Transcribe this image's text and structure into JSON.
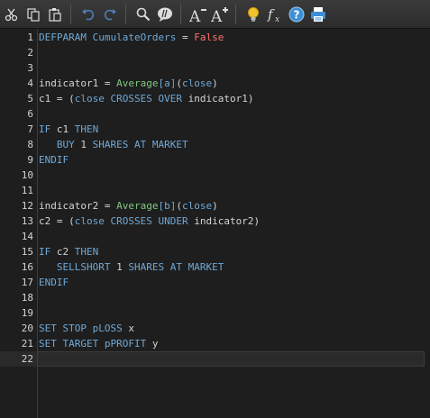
{
  "toolbar": {
    "icons": [
      "scissors-icon",
      "copy-icon",
      "paste-icon",
      "undo-icon",
      "redo-icon",
      "search-icon",
      "comment-icon",
      "decrease-font-icon",
      "increase-font-icon",
      "lightbulb-icon",
      "function-icon",
      "help-icon",
      "print-icon"
    ],
    "colors": {
      "bulb": "#f2c230",
      "help": "#3d8fd6",
      "print": "#3d8fd6"
    }
  },
  "editor": {
    "lines": [
      {
        "n": "1",
        "tokens": [
          [
            "kw",
            "DEFPARAM CumulateOrders"
          ],
          [
            "tx",
            " = "
          ],
          [
            "bl",
            "False"
          ]
        ]
      },
      {
        "n": "2",
        "tokens": []
      },
      {
        "n": "3",
        "tokens": []
      },
      {
        "n": "4",
        "tokens": [
          [
            "tx",
            "indicator1 = "
          ],
          [
            "fn",
            "Average"
          ],
          [
            "br",
            "[a]"
          ],
          [
            "tx",
            "("
          ],
          [
            "kw",
            "close"
          ],
          [
            "tx",
            ")"
          ]
        ]
      },
      {
        "n": "5",
        "tokens": [
          [
            "tx",
            "c1 = ("
          ],
          [
            "kw",
            "close CROSSES OVER"
          ],
          [
            "tx",
            " indicator1)"
          ]
        ]
      },
      {
        "n": "6",
        "tokens": []
      },
      {
        "n": "7",
        "tokens": [
          [
            "kw",
            "IF"
          ],
          [
            "tx",
            " c1 "
          ],
          [
            "kw",
            "THEN"
          ]
        ]
      },
      {
        "n": "8",
        "tokens": [
          [
            "tx",
            "   "
          ],
          [
            "kw",
            "BUY"
          ],
          [
            "tx",
            " 1 "
          ],
          [
            "kw",
            "SHARES AT MARKET"
          ]
        ]
      },
      {
        "n": "9",
        "tokens": [
          [
            "kw",
            "ENDIF"
          ]
        ]
      },
      {
        "n": "10",
        "tokens": []
      },
      {
        "n": "11",
        "tokens": []
      },
      {
        "n": "12",
        "tokens": [
          [
            "tx",
            "indicator2 = "
          ],
          [
            "fn",
            "Average"
          ],
          [
            "br",
            "[b]"
          ],
          [
            "tx",
            "("
          ],
          [
            "kw",
            "close"
          ],
          [
            "tx",
            ")"
          ]
        ]
      },
      {
        "n": "13",
        "tokens": [
          [
            "tx",
            "c2 = ("
          ],
          [
            "kw",
            "close CROSSES UNDER"
          ],
          [
            "tx",
            " indicator2)"
          ]
        ]
      },
      {
        "n": "14",
        "tokens": []
      },
      {
        "n": "15",
        "tokens": [
          [
            "kw",
            "IF"
          ],
          [
            "tx",
            " c2 "
          ],
          [
            "kw",
            "THEN"
          ]
        ]
      },
      {
        "n": "16",
        "tokens": [
          [
            "tx",
            "   "
          ],
          [
            "kw",
            "SELLSHORT"
          ],
          [
            "tx",
            " 1 "
          ],
          [
            "kw",
            "SHARES AT MARKET"
          ]
        ]
      },
      {
        "n": "17",
        "tokens": [
          [
            "kw",
            "ENDIF"
          ]
        ]
      },
      {
        "n": "18",
        "tokens": []
      },
      {
        "n": "19",
        "tokens": []
      },
      {
        "n": "20",
        "tokens": [
          [
            "kw",
            "SET STOP pLOSS"
          ],
          [
            "tx",
            " x"
          ]
        ]
      },
      {
        "n": "21",
        "tokens": [
          [
            "kw",
            "SET TARGET pPROFIT"
          ],
          [
            "tx",
            " y"
          ]
        ]
      },
      {
        "n": "22",
        "tokens": []
      }
    ],
    "current_line": "22"
  }
}
